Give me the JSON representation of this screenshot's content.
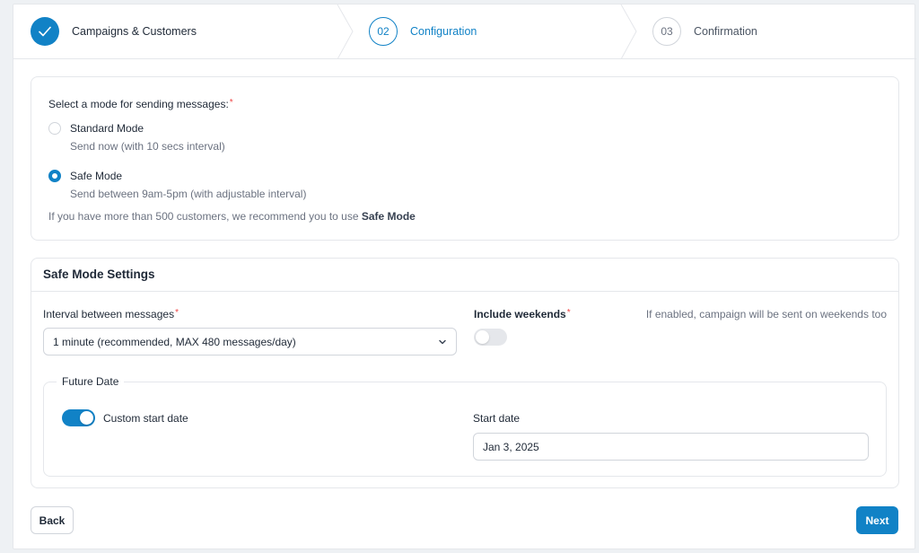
{
  "stepper": {
    "steps": [
      {
        "number": "",
        "label": "Campaigns & Customers",
        "status": "completed",
        "icon": "check-icon"
      },
      {
        "number": "02",
        "label": "Configuration",
        "status": "active"
      },
      {
        "number": "03",
        "label": "Confirmation",
        "status": "pending"
      }
    ]
  },
  "mode": {
    "question": "Select a mode for sending messages:",
    "required_mark": "*",
    "options": [
      {
        "title": "Standard Mode",
        "description": "Send now (with 10 secs interval)",
        "selected": false
      },
      {
        "title": "Safe Mode",
        "description": "Send between 9am-5pm (with adjustable interval)",
        "selected": true
      }
    ],
    "recommendation_prefix": "If you have more than 500 customers, we recommend you to use ",
    "recommendation_emphasis": "Safe Mode"
  },
  "settings": {
    "title": "Safe Mode Settings",
    "interval_label": "Interval between messages",
    "interval_value": "1 minute (recommended, MAX 480 messages/day)",
    "weekends_label": "Include weekends",
    "weekends_hint": "If enabled, campaign will be sent on weekends too",
    "weekends_enabled": false,
    "future_date": {
      "legend": "Future Date",
      "custom_start_label": "Custom start date",
      "custom_start_enabled": true,
      "start_date_label": "Start date",
      "start_date_value": "Jan 3, 2025"
    }
  },
  "footer": {
    "back_label": "Back",
    "next_label": "Next"
  },
  "colors": {
    "accent": "#1182c6",
    "required": "#ef4444",
    "muted_text": "#6b7280"
  }
}
